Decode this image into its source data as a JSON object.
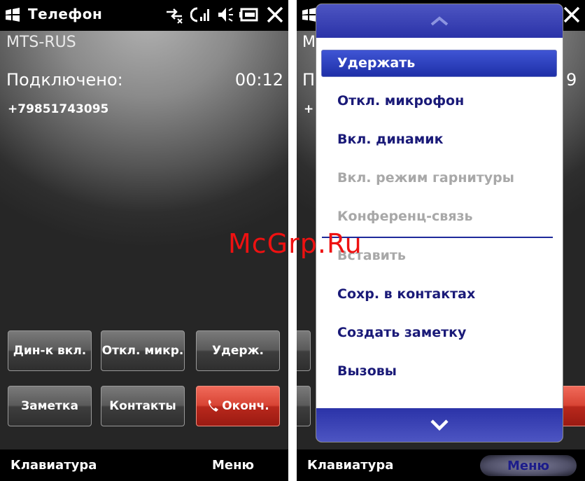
{
  "status": {
    "title": "Телефон"
  },
  "call": {
    "operator": "MTS-RUS",
    "state": "Подключено:",
    "timer": "00:12",
    "number": "+79851743095"
  },
  "buttons": {
    "speaker": "Дин-к вкл.",
    "mute": "Откл. микр.",
    "hold": "Удерж.",
    "note": "Заметка",
    "contacts": "Контакты",
    "end": "Оконч."
  },
  "softkeys": {
    "left": "Клавиатура",
    "right": "Меню"
  },
  "menu": {
    "items": [
      {
        "label": "Удержать",
        "enabled": true,
        "selected": true
      },
      {
        "label": "Откл. микрофон",
        "enabled": true
      },
      {
        "label": "Вкл. динамик",
        "enabled": true
      },
      {
        "label": "Вкл. режим гарнитуры",
        "enabled": false
      },
      {
        "label": "Конференц-связь",
        "enabled": false
      },
      {
        "label": "Вставить",
        "enabled": false
      },
      {
        "label": "Сохр. в контактах",
        "enabled": true
      },
      {
        "label": "Создать заметку",
        "enabled": true
      },
      {
        "label": "Вызовы",
        "enabled": true
      }
    ]
  },
  "peek": {
    "op_letter": "M",
    "timer_tail": "9",
    "state_letter": "П",
    "number_letter": "+"
  },
  "watermark": "McGrp.Ru",
  "colors": {
    "menu_text": "#1a1a78",
    "highlight": "#2b3cb8",
    "end_call": "#d84434"
  }
}
